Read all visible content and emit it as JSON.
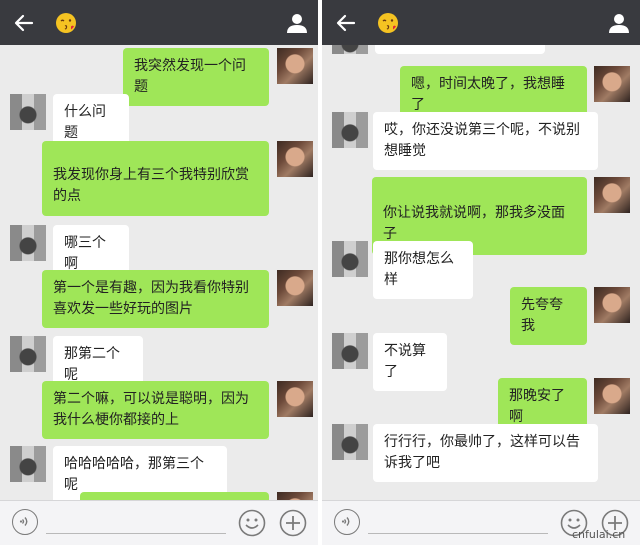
{
  "left_panel": {
    "messages": [
      {
        "side": "self",
        "text": "我突然发现一个问题"
      },
      {
        "side": "other",
        "text": "什么问题"
      },
      {
        "side": "self",
        "text": "我发现你身上有三个我特别欣赏的点"
      },
      {
        "side": "other",
        "text": "哪三个啊"
      },
      {
        "side": "self",
        "text": "第一个是有趣，因为我看你特别喜欢发一些好玩的图片"
      },
      {
        "side": "other",
        "text": "那第二个呢"
      },
      {
        "side": "self",
        "text": "第二个嘛，可以说是聪明，因为我什么梗你都接的上"
      },
      {
        "side": "other",
        "text": "哈哈哈哈哈，那第三个呢"
      }
    ]
  },
  "right_panel": {
    "messages": [
      {
        "side": "self",
        "text": "嗯，时间太晚了，我想睡了"
      },
      {
        "side": "other",
        "text": "哎，你还没说第三个呢，不说别想睡觉"
      },
      {
        "side": "self",
        "text": "你让说我就说啊，那我多没面子"
      },
      {
        "side": "other",
        "text": "那你想怎么样"
      },
      {
        "side": "self",
        "text": "先夸夸我"
      },
      {
        "side": "other",
        "text": "不说算了"
      },
      {
        "side": "self",
        "text": "那晚安了啊"
      },
      {
        "side": "other",
        "text": "行行行，你最帅了，这样可以告诉我了吧"
      }
    ]
  },
  "topbar": {
    "back_icon": "arrow-left",
    "contact_icon": "kissing-face-emoji",
    "profile_icon": "user-silhouette"
  },
  "bottombar": {
    "voice_icon": "voice-circle",
    "emoji_icon": "smiley-face",
    "more_icon": "plus-circle",
    "input_placeholder": ""
  },
  "colors": {
    "topbar": "#393a3f",
    "chat_bg": "#ebebeb",
    "self_bubble": "#9fe658",
    "other_bubble": "#ffffff"
  },
  "watermark": "cnfulai.cn"
}
